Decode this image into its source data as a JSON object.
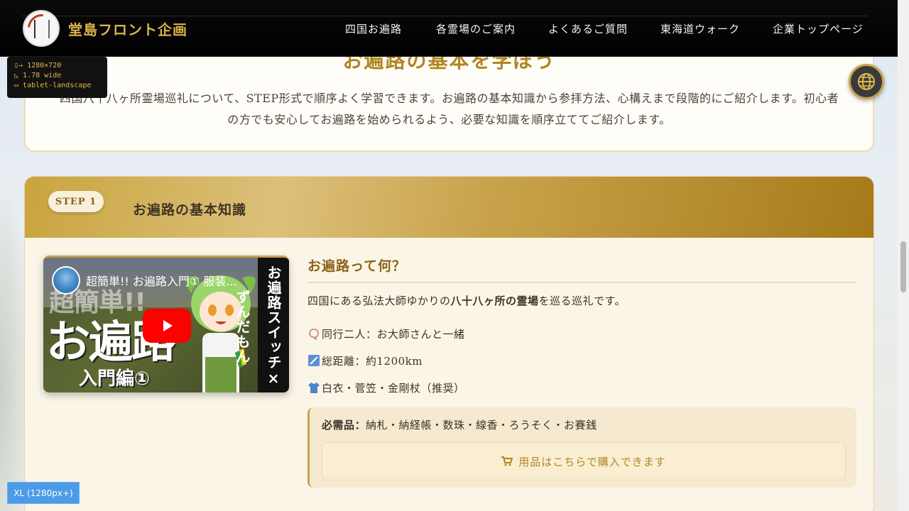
{
  "header": {
    "brand": "堂島フロント企画",
    "logo": "dojima-front-kikaku-logo",
    "nav": [
      {
        "label": "四国お遍路"
      },
      {
        "label": "各霊場のご案内"
      },
      {
        "label": "よくあるご質問"
      },
      {
        "label": "東海道ウォーク"
      },
      {
        "label": "企業トップページ"
      }
    ]
  },
  "device_badge": {
    "dims": "1280×720",
    "ratio": "1.78 wide",
    "mode": "tablet-landscape"
  },
  "intro": {
    "title": "お遍路の基本を学ぼう",
    "text": "四国八十八ヶ所霊場巡礼について、STEP形式で順序よく学習できます。お遍路の基本知識から参拝方法、心構えまで段階的にご紹介します。初心者の方でも安心してお遍路を始められるよう、必要な知識を順序立ててご紹介します。"
  },
  "step": {
    "badge": "STEP 1",
    "title": "お遍路の基本知識",
    "video": {
      "title": "超簡単!! お遍路入門① 服装...",
      "thumb_top": "超簡単!!",
      "thumb_main": "お遍路",
      "thumb_sub": "入門編①",
      "side_band": "お遍路スイッチ×ずんだもん",
      "channel_icon": "travel-channel-avatar"
    },
    "question": "お遍路って何？",
    "desc_pre": "四国にある弘法大師ゆかりの",
    "desc_bold": "八十八ヶ所の霊場",
    "desc_post": "を巡る巡礼です。",
    "facts": [
      {
        "icon": "companion-icon",
        "text": "同行二人：お大師さんと一緒"
      },
      {
        "icon": "distance-icon",
        "text": "総距離：約1200km"
      },
      {
        "icon": "shirt-icon",
        "text": "白衣・菅笠・金剛杖（推奨）"
      }
    ],
    "needs_label": "必需品：",
    "needs_items": "納札・納経帳・数珠・線香・ろうそく・お賽銭",
    "shop_label": "用品はこちらで購入できます"
  },
  "breakpoint_badge": "XL (1280px+)",
  "colors": {
    "accent_gold": "#c9a24a",
    "brand_gold": "#d9b24a",
    "header_bg": "#000000",
    "youtube_red": "#ff0000"
  }
}
